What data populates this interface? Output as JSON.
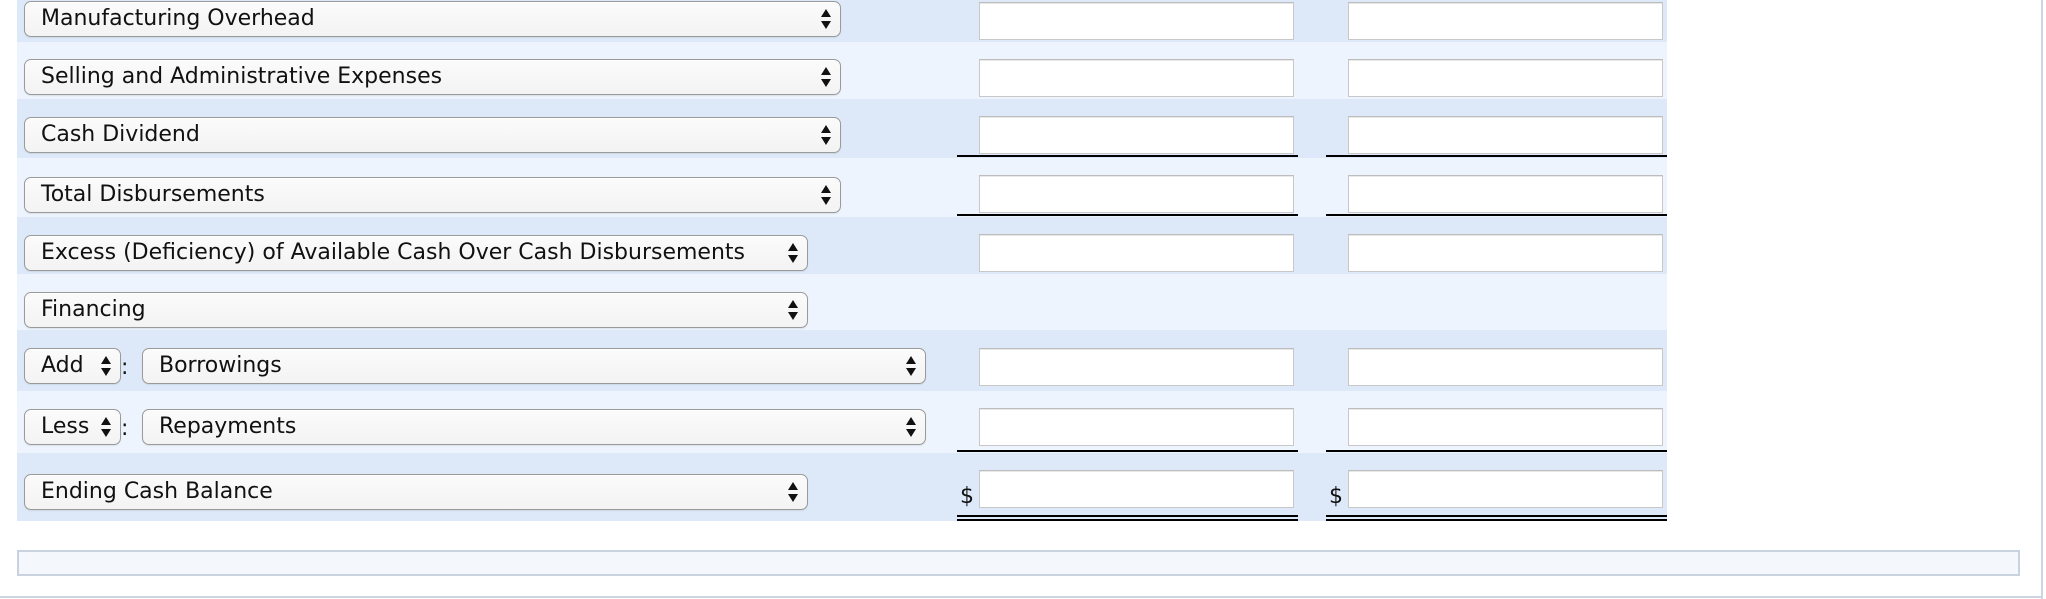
{
  "form": {
    "rows": [
      {
        "label": "Manufacturing Overhead",
        "col1_value": "",
        "col2_value": ""
      },
      {
        "label": "Selling and Administrative Expenses",
        "col1_value": "",
        "col2_value": ""
      },
      {
        "label": "Cash Dividend",
        "col1_value": "",
        "col2_value": ""
      },
      {
        "label": "Total Disbursements",
        "col1_value": "",
        "col2_value": ""
      },
      {
        "label": "Excess (Deficiency) of Available Cash Over Cash Disbursements",
        "col1_value": "",
        "col2_value": ""
      },
      {
        "label": "Financing"
      },
      {
        "operator": "Add",
        "separator": ":",
        "label": "Borrowings",
        "col1_value": "",
        "col2_value": ""
      },
      {
        "operator": "Less",
        "separator": ":",
        "label": "Repayments",
        "col1_value": "",
        "col2_value": ""
      },
      {
        "label": "Ending Cash Balance",
        "currency_symbol": "$",
        "col1_value": "",
        "col2_value": ""
      }
    ]
  },
  "icons": {
    "select_arrows": "up-down-arrows-icon"
  }
}
